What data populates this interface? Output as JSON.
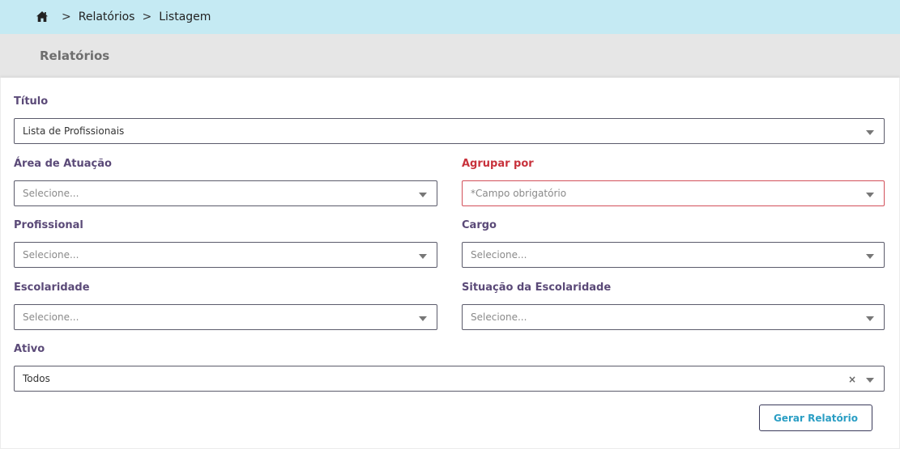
{
  "breadcrumb": {
    "items": [
      "Relatórios",
      "Listagem"
    ],
    "separator": ">"
  },
  "page": {
    "title": "Relatórios"
  },
  "form": {
    "titulo": {
      "label": "Título",
      "value": "Lista de Profissionais"
    },
    "area_atuacao": {
      "label": "Área de Atuação",
      "placeholder": "Selecione..."
    },
    "agrupar_por": {
      "label": "Agrupar por",
      "placeholder": "*Campo obrigatório"
    },
    "profissional": {
      "label": "Profissional",
      "placeholder": "Selecione..."
    },
    "cargo": {
      "label": "Cargo",
      "placeholder": "Selecione..."
    },
    "escolaridade": {
      "label": "Escolaridade",
      "placeholder": "Selecione..."
    },
    "situacao_escolaridade": {
      "label": "Situação da Escolaridade",
      "placeholder": "Selecione..."
    },
    "ativo": {
      "label": "Ativo",
      "value": "Todos",
      "clear": "×"
    }
  },
  "actions": {
    "generate_label": "Gerar Relatório"
  },
  "colors": {
    "breadcrumb_bg": "#c5eaf3",
    "label": "#5b4a78",
    "error": "#c8323c",
    "button_text": "#2a9ec4"
  }
}
